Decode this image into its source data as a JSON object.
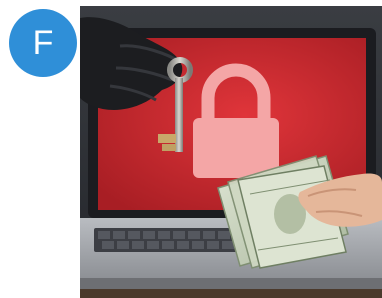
{
  "badge": {
    "letter": "F",
    "color": "#2f8fd8"
  },
  "photo": {
    "subject": "ransomware-key-for-cash",
    "screen_color": "#c9262c",
    "lock_icon": "padlock-icon"
  }
}
